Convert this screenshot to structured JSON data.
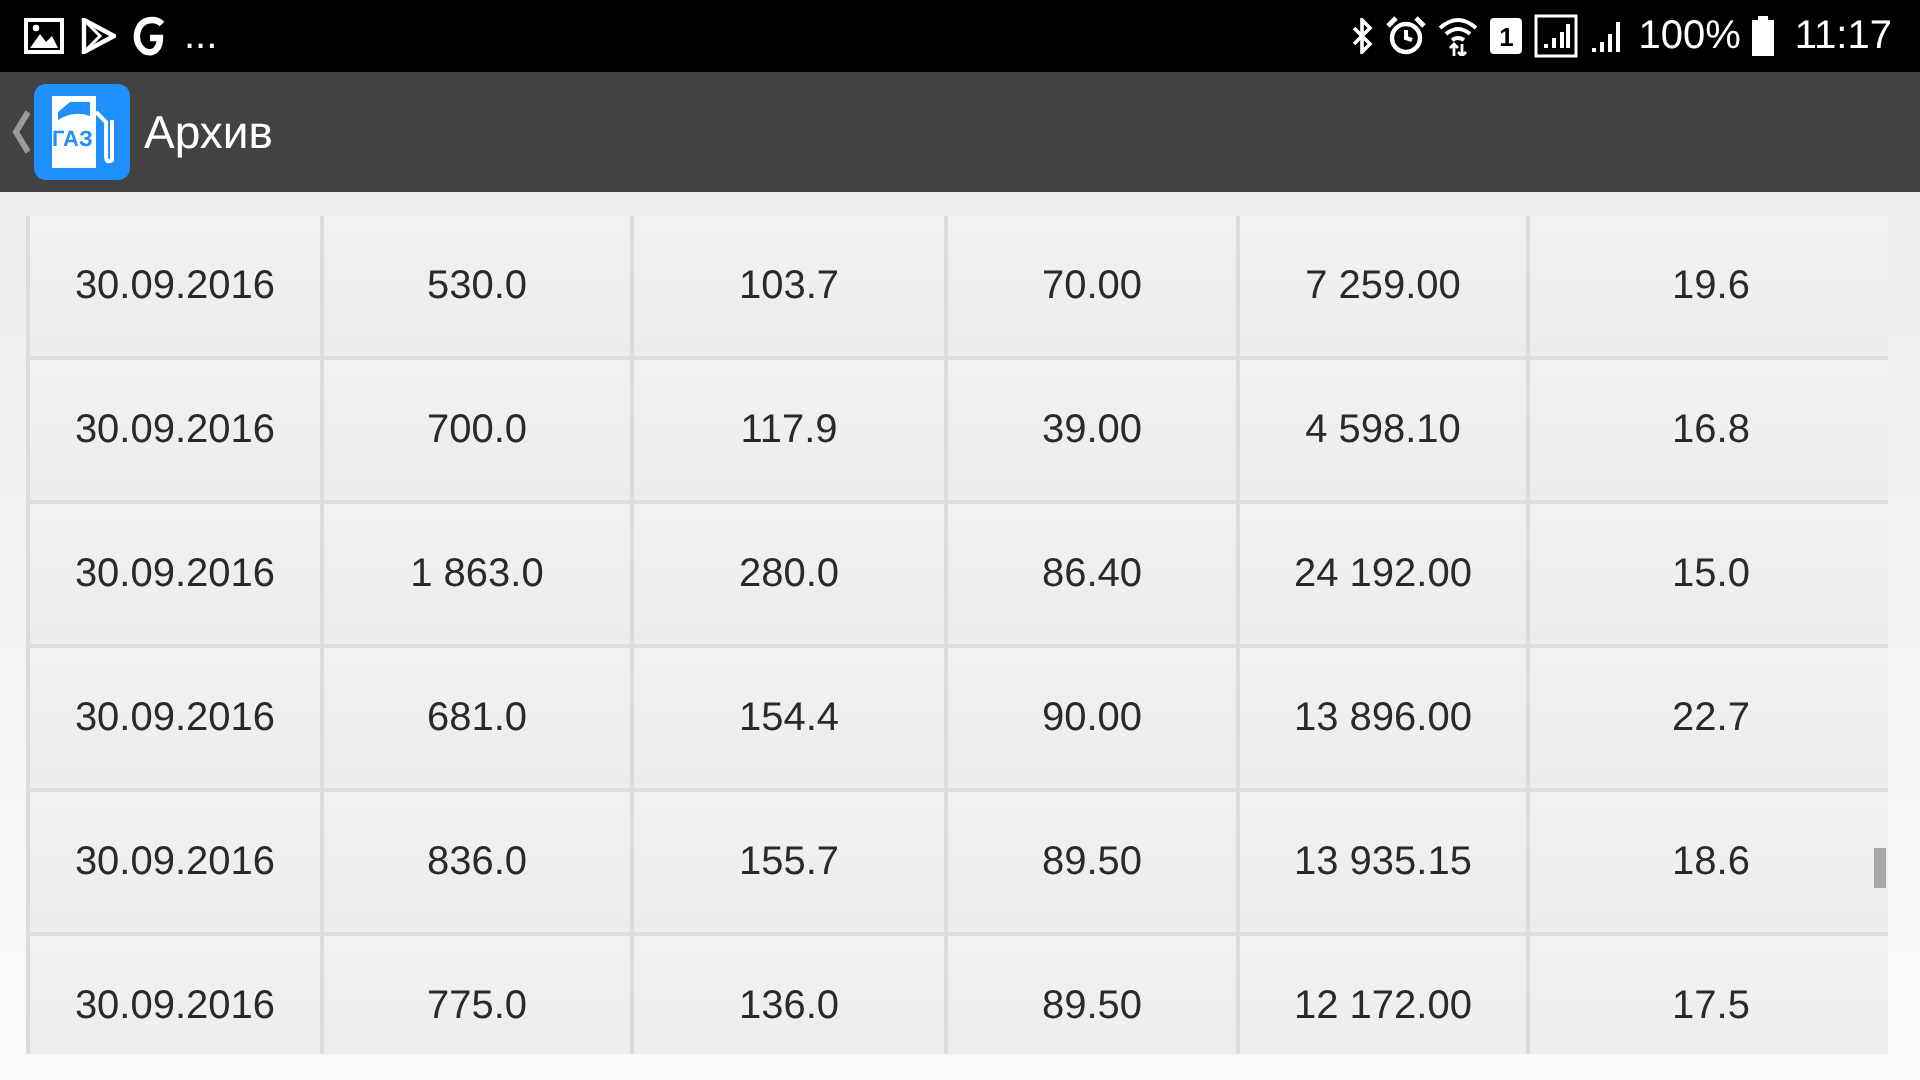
{
  "status_bar": {
    "overflow": "...",
    "sim_slot": "1",
    "battery": "100%",
    "time": "11:17"
  },
  "toolbar": {
    "app_icon_label": "ГАЗ",
    "title": "Архив"
  },
  "table": {
    "rows": [
      [
        "30.09.2016",
        "530.0",
        "103.7",
        "70.00",
        "7 259.00",
        "19.6"
      ],
      [
        "30.09.2016",
        "700.0",
        "117.9",
        "39.00",
        "4 598.10",
        "16.8"
      ],
      [
        "30.09.2016",
        "1 863.0",
        "280.0",
        "86.40",
        "24 192.00",
        "15.0"
      ],
      [
        "30.09.2016",
        "681.0",
        "154.4",
        "90.00",
        "13 896.00",
        "22.7"
      ],
      [
        "30.09.2016",
        "836.0",
        "155.7",
        "89.50",
        "13 935.15",
        "18.6"
      ],
      [
        "30.09.2016",
        "775.0",
        "136.0",
        "89.50",
        "12 172.00",
        "17.5"
      ]
    ]
  }
}
